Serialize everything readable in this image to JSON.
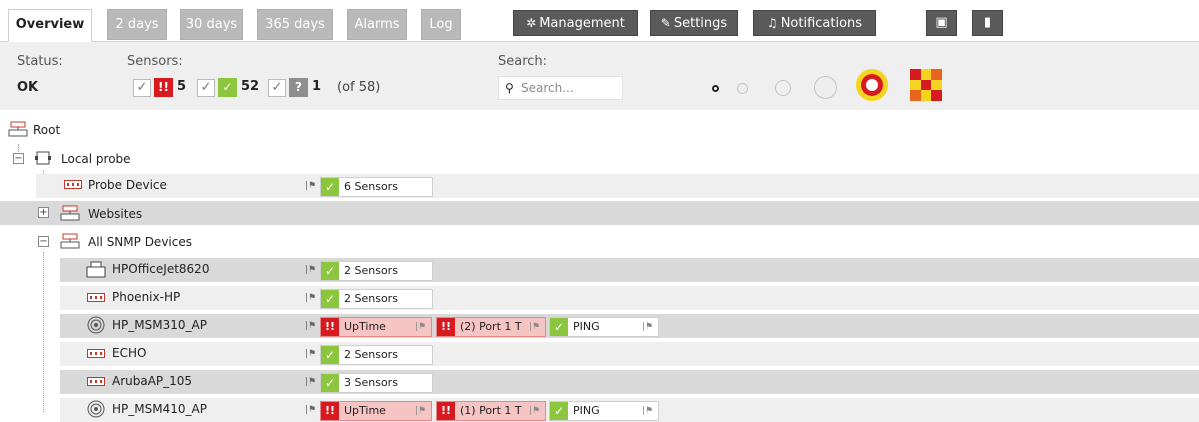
{
  "tabs": [
    {
      "label": "Overview"
    },
    {
      "label": "2 days"
    },
    {
      "label": "30 days"
    },
    {
      "label": "365 days"
    },
    {
      "label": "Alarms"
    },
    {
      "label": "Log"
    }
  ],
  "toolbar": {
    "management_label": "Management",
    "settings_label": "Settings",
    "notifications_label": "Notifications"
  },
  "status": {
    "label": "Status:",
    "value": "OK"
  },
  "sensors": {
    "label": "Sensors:",
    "down_count": "5",
    "up_count": "52",
    "unknown_count": "1",
    "total": "(of 58)"
  },
  "search": {
    "label": "Search:",
    "placeholder": "Search..."
  },
  "tree": {
    "root_label": "Root",
    "probe_label": "Local probe",
    "groups": {
      "websites": "Websites",
      "snmp": "All SNMP Devices"
    },
    "devices": [
      {
        "name": "Probe Device",
        "sensors": "6 Sensors"
      },
      {
        "name": "HPOfficeJet8620",
        "sensors": "2 Sensors"
      },
      {
        "name": "Phoenix-HP",
        "sensors": "2 Sensors"
      },
      {
        "name": "HP_MSM310_AP",
        "s1": "UpTime",
        "s2": "(2) Port 1 T",
        "s3": "PING"
      },
      {
        "name": "ECHO",
        "sensors": "2 Sensors"
      },
      {
        "name": "ArubaAP_105",
        "sensors": "3 Sensors"
      },
      {
        "name": "HP_MSM410_AP",
        "s1": "UpTime",
        "s2": "(1) Port 1 T",
        "s3": "PING"
      }
    ]
  },
  "colors": {
    "down": "#d71920",
    "up": "#8cc63f",
    "unknown": "#8e8e8e",
    "button_dark": "#5a5a5a",
    "tab_inactive": "#b9b9b9"
  }
}
